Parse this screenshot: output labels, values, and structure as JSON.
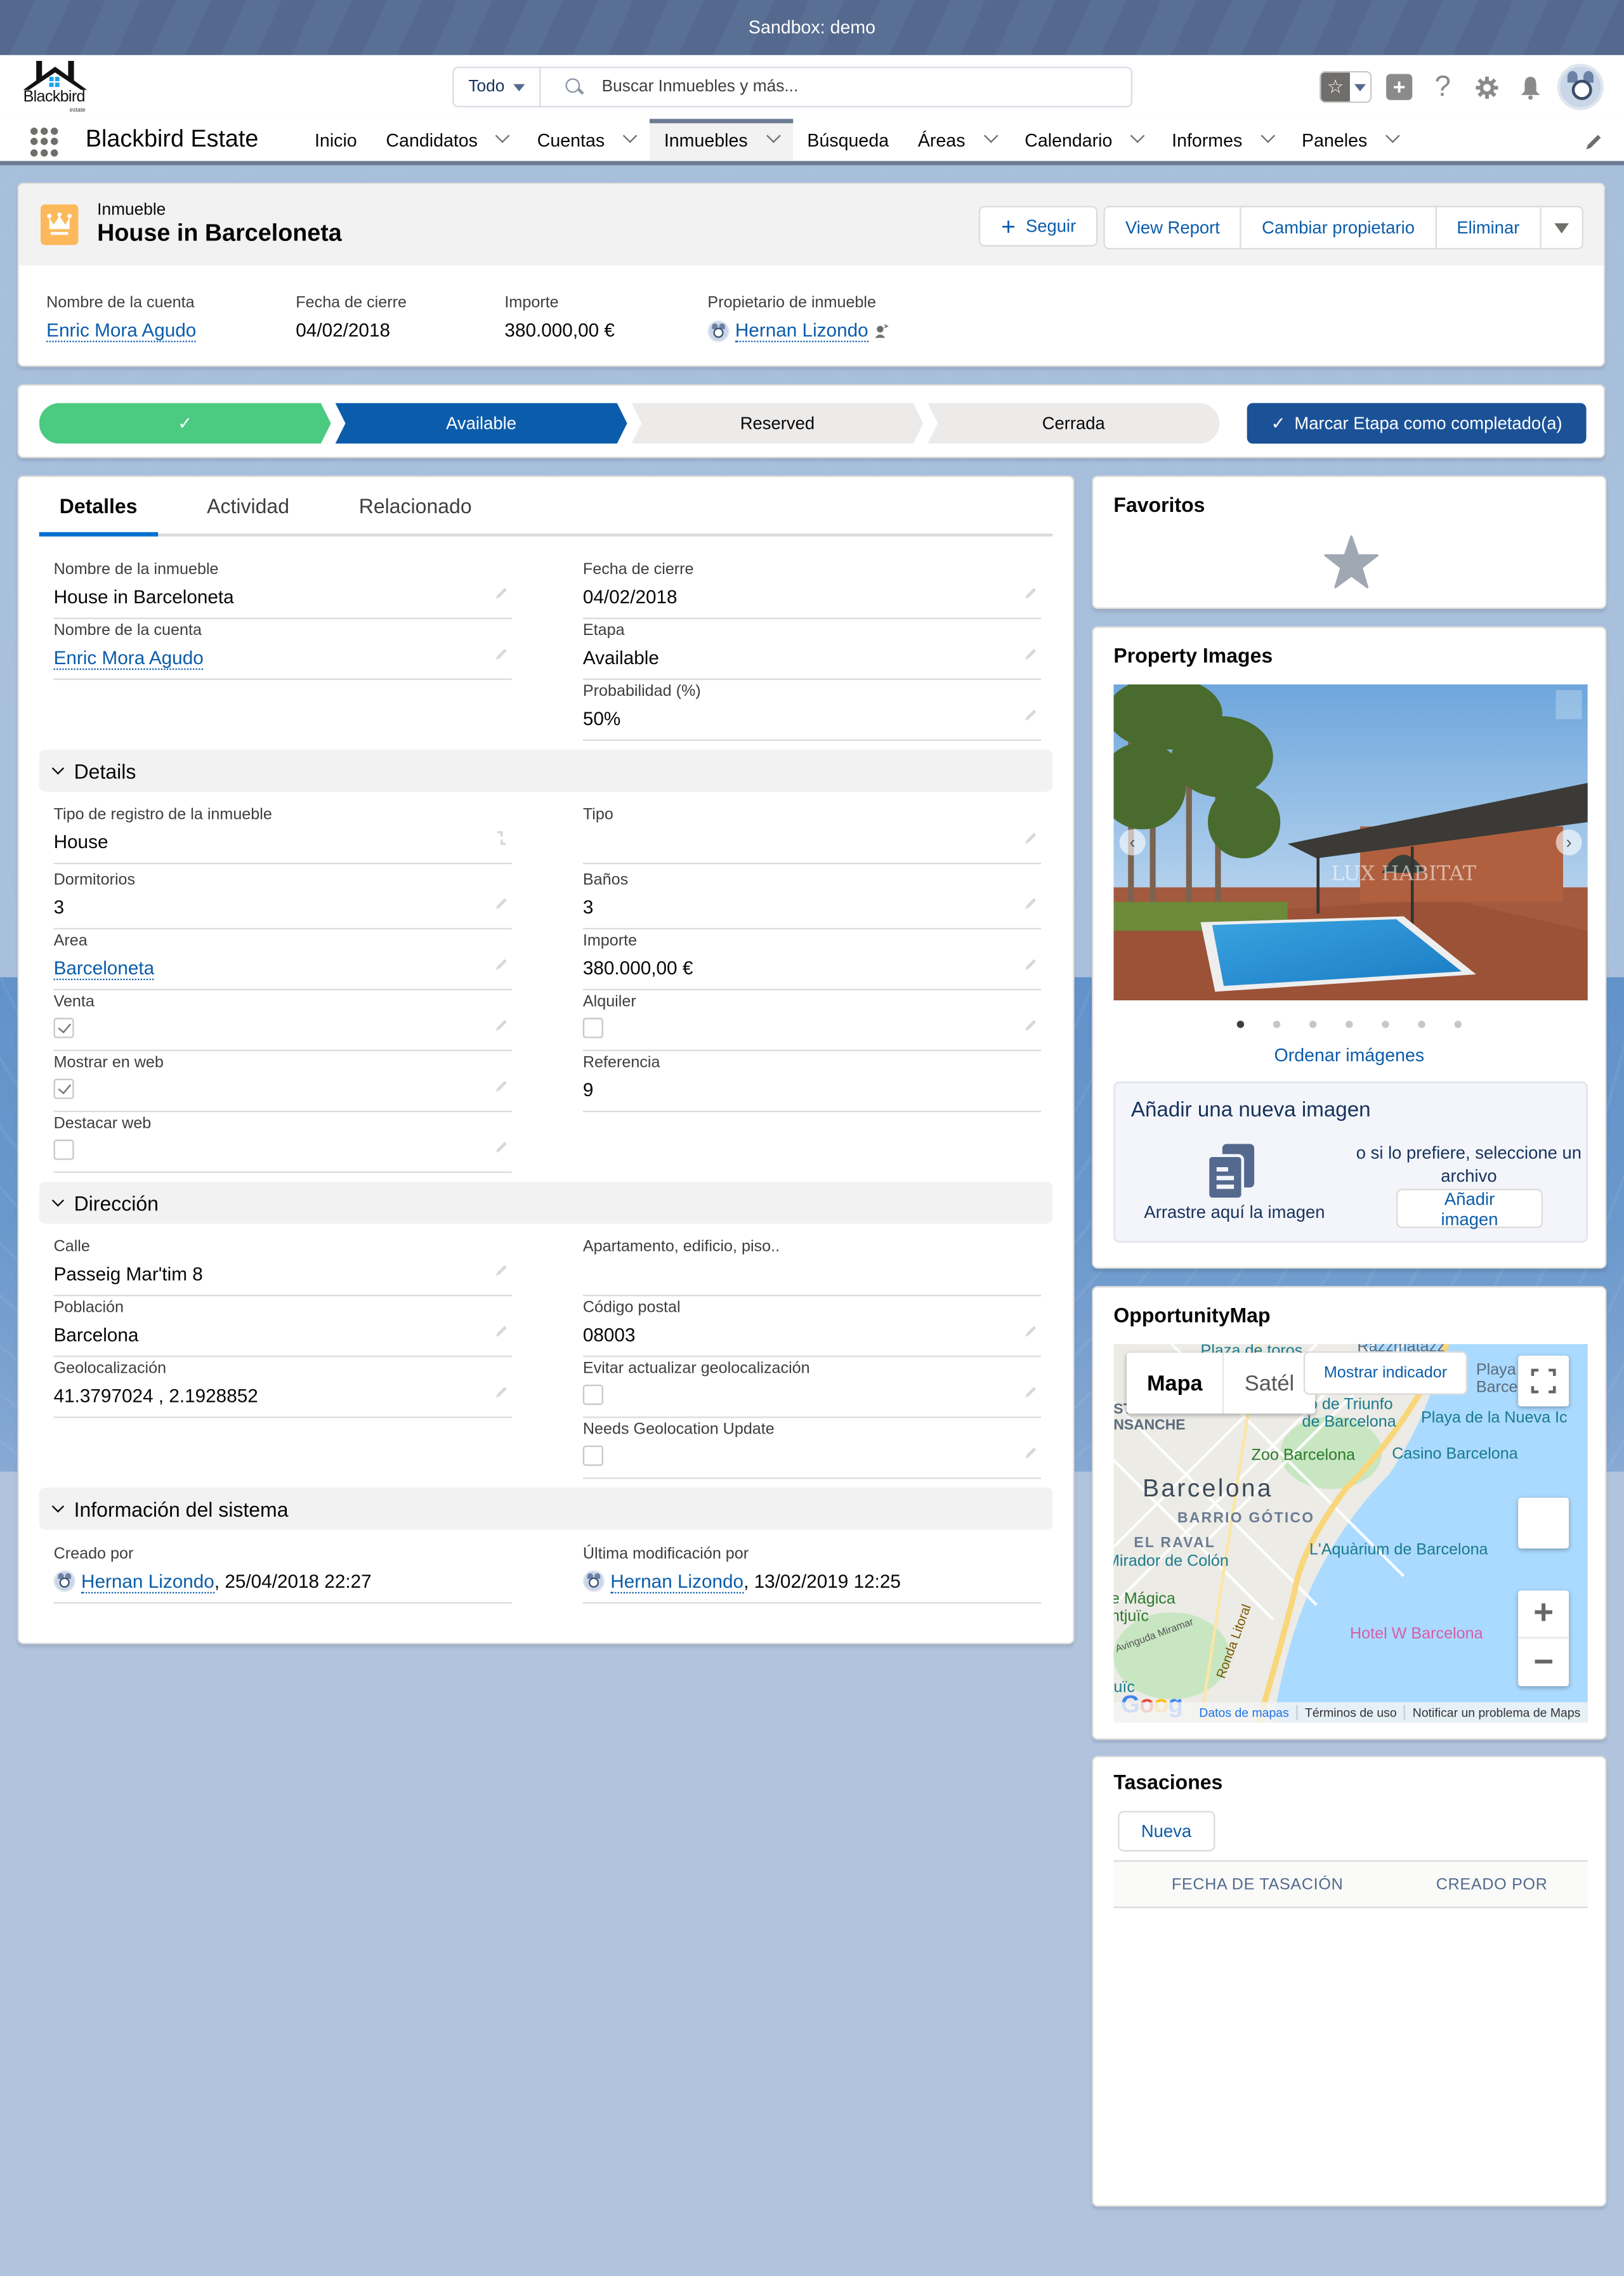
{
  "sandbox_bar": {
    "text": "Sandbox: demo"
  },
  "header": {
    "logo": {
      "name": "Blackbird",
      "tagline": "estate"
    },
    "search": {
      "scope": "Todo",
      "placeholder": "Buscar Inmuebles y más..."
    },
    "icons": [
      "favorites-star-icon",
      "global-actions-plus-icon",
      "help-icon",
      "setup-gear-icon",
      "notifications-bell-icon",
      "user-avatar"
    ]
  },
  "app_nav": {
    "app_name": "Blackbird Estate",
    "items": [
      {
        "label": "Inicio",
        "dropdown": false,
        "active": false
      },
      {
        "label": "Candidatos",
        "dropdown": true,
        "active": false
      },
      {
        "label": "Cuentas",
        "dropdown": true,
        "active": false
      },
      {
        "label": "Inmuebles",
        "dropdown": true,
        "active": true
      },
      {
        "label": "Búsqueda",
        "dropdown": false,
        "active": false
      },
      {
        "label": "Áreas",
        "dropdown": true,
        "active": false
      },
      {
        "label": "Calendario",
        "dropdown": true,
        "active": false
      },
      {
        "label": "Informes",
        "dropdown": true,
        "active": false
      },
      {
        "label": "Paneles",
        "dropdown": true,
        "active": false
      }
    ]
  },
  "record": {
    "object_label": "Inmueble",
    "title": "House in Barceloneta",
    "icon_color": "#fcb95b",
    "actions": {
      "follow": "Seguir",
      "view_report": "View Report",
      "change_owner": "Cambiar propietario",
      "delete": "Eliminar"
    },
    "highlights": [
      {
        "label": "Nombre de la cuenta",
        "value": "Enric Mora Agudo",
        "link": true
      },
      {
        "label": "Fecha de cierre",
        "value": "04/02/2018",
        "link": false
      },
      {
        "label": "Importe",
        "value": "380.000,00 €",
        "link": false
      },
      {
        "label": "Propietario de inmueble",
        "value": "Hernan Lizondo",
        "link": true
      }
    ]
  },
  "path": {
    "steps": [
      {
        "label": "✓",
        "state": "complete"
      },
      {
        "label": "Available",
        "state": "current"
      },
      {
        "label": "Reserved",
        "state": "incomplete"
      },
      {
        "label": "Cerrada",
        "state": "incomplete"
      }
    ],
    "mark_complete": "Marcar Etapa como completado(a)",
    "colors": {
      "complete": "#4bca81",
      "current": "#0b5cab",
      "button": "#1b5297"
    }
  },
  "detail": {
    "tabs": [
      {
        "label": "Detalles",
        "active": true
      },
      {
        "label": "Actividad",
        "active": false
      },
      {
        "label": "Relacionado",
        "active": false
      }
    ],
    "top_fields": {
      "name": {
        "label": "Nombre de la inmueble",
        "value": "House in Barceloneta"
      },
      "close_date": {
        "label": "Fecha de cierre",
        "value": "04/02/2018"
      },
      "account": {
        "label": "Nombre de la cuenta",
        "value": "Enric Mora Agudo"
      },
      "stage": {
        "label": "Etapa",
        "value": "Available"
      },
      "probability": {
        "label": "Probabilidad (%)",
        "value": "50%"
      }
    },
    "sections": {
      "details": {
        "title": "Details",
        "record_type": {
          "label": "Tipo de registro de la inmueble",
          "value": "House"
        },
        "type": {
          "label": "Tipo",
          "value": ""
        },
        "bedrooms": {
          "label": "Dormitorios",
          "value": "3"
        },
        "bathrooms": {
          "label": "Baños",
          "value": "3"
        },
        "area": {
          "label": "Area",
          "value": "Barceloneta"
        },
        "amount": {
          "label": "Importe",
          "value": "380.000,00 €"
        },
        "sale": {
          "label": "Venta",
          "checked": true
        },
        "rent": {
          "label": "Alquiler",
          "checked": false
        },
        "show_web": {
          "label": "Mostrar en web",
          "checked": true
        },
        "reference": {
          "label": "Referencia",
          "value": "9"
        },
        "featured_web": {
          "label": "Destacar web",
          "checked": false
        }
      },
      "address": {
        "title": "Dirección",
        "street": {
          "label": "Calle",
          "value": "Passeig Mar'tim 8"
        },
        "apartment": {
          "label": "Apartamento, edificio, piso..",
          "value": ""
        },
        "city": {
          "label": "Población",
          "value": "Barcelona"
        },
        "postal_code": {
          "label": "Código postal",
          "value": "08003"
        },
        "geolocation": {
          "label": "Geolocalización",
          "value": "41.3797024 , 2.1928852"
        },
        "avoid_geo_update": {
          "label": "Evitar actualizar geolocalización",
          "checked": false
        },
        "needs_geo_update": {
          "label": "Needs Geolocation Update",
          "checked": false
        }
      },
      "system": {
        "title": "Información del sistema",
        "created_by": {
          "label": "Creado por",
          "user": "Hernan Lizondo",
          "date": ", 25/04/2018 22:27"
        },
        "modified_by": {
          "label": "Última modificación por",
          "user": "Hernan Lizondo",
          "date": ", 13/02/2019 12:25"
        }
      }
    }
  },
  "sidebar": {
    "favorites": {
      "title": "Favoritos"
    },
    "images": {
      "title": "Property Images",
      "watermark": "LUX HABITAT",
      "image_count": 7,
      "current_index": 1,
      "order_link": "Ordenar imágenes",
      "upload": {
        "title": "Añadir una nueva imagen",
        "drag_text": "Arrastre aquí la imagen",
        "or_text": "o si lo prefiere, seleccione un archivo",
        "button": "Añadir imagen"
      }
    },
    "map": {
      "title": "OpportunityMap",
      "type_map": "Mapa",
      "type_satellite": "Satél",
      "show_marker": "Mostrar indicador",
      "labels": {
        "plaza_toros": "Plaza de toros",
        "razzmatazz": "Razzmatazz",
        "distrito1": "STRITO DEL",
        "distrito2": "NSANCHE",
        "arco1": "Arco de Triunfo",
        "arco2": "de Barcelona",
        "playa_nueva": "Playa de la Nueva Ic",
        "playa_top1": "Playa d",
        "playa_top2": "Barcel",
        "zoo": "Zoo Barcelona",
        "casino": "Casino Barcelona",
        "barcelona": "Barcelona",
        "gotico": "BARRIO GÓTICO",
        "raval": "EL RAVAL",
        "mirador": "Mirador de Colón",
        "aquarium": "L'Aquàrium de Barcelona",
        "magica1": "e Mágica",
        "magica2": "ntjuïc",
        "miramar": "Avinguda Miramar",
        "ronda": "Ronda Litoral",
        "hotel": "Hotel W Barcelona",
        "montjuic": "uïc"
      },
      "footer": {
        "data": "Datos de mapas",
        "terms": "Términos de uso",
        "report": "Notificar un problema de Maps"
      },
      "google": "Google"
    },
    "appraisals": {
      "title": "Tasaciones",
      "new_button": "Nueva",
      "columns": [
        "FECHA DE TASACIÓN",
        "CREADO POR"
      ],
      "rows": []
    }
  }
}
